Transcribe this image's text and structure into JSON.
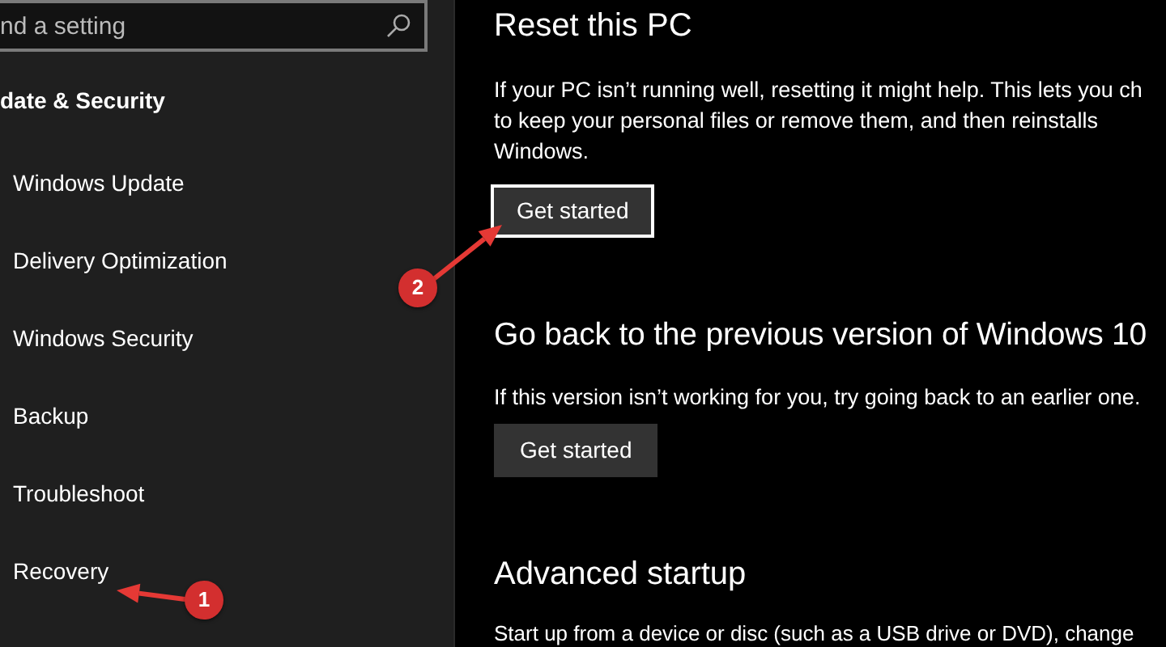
{
  "sidebar": {
    "search": {
      "placeholder": "nd a setting"
    },
    "heading": "date & Security",
    "items": [
      {
        "label": "Windows Update"
      },
      {
        "label": "Delivery Optimization"
      },
      {
        "label": "Windows Security"
      },
      {
        "label": "Backup"
      },
      {
        "label": "Troubleshoot"
      },
      {
        "label": "Recovery"
      }
    ]
  },
  "sections": [
    {
      "title": "Reset this PC",
      "description": "If your PC isn’t running well, resetting it might help. This lets you ch\nto keep your personal files or remove them, and then reinstalls\nWindows.",
      "button": {
        "label": "Get started",
        "focused": true
      }
    },
    {
      "title": "Go back to the previous version of Windows 10",
      "description": "If this version isn’t working for you, try going back to an earlier one.",
      "button": {
        "label": "Get started",
        "focused": false
      }
    },
    {
      "title": "Advanced startup",
      "description": "Start up from a device or disc (such as a USB drive or DVD), change"
    }
  ],
  "annotations": [
    {
      "number": "1"
    },
    {
      "number": "2"
    }
  ]
}
